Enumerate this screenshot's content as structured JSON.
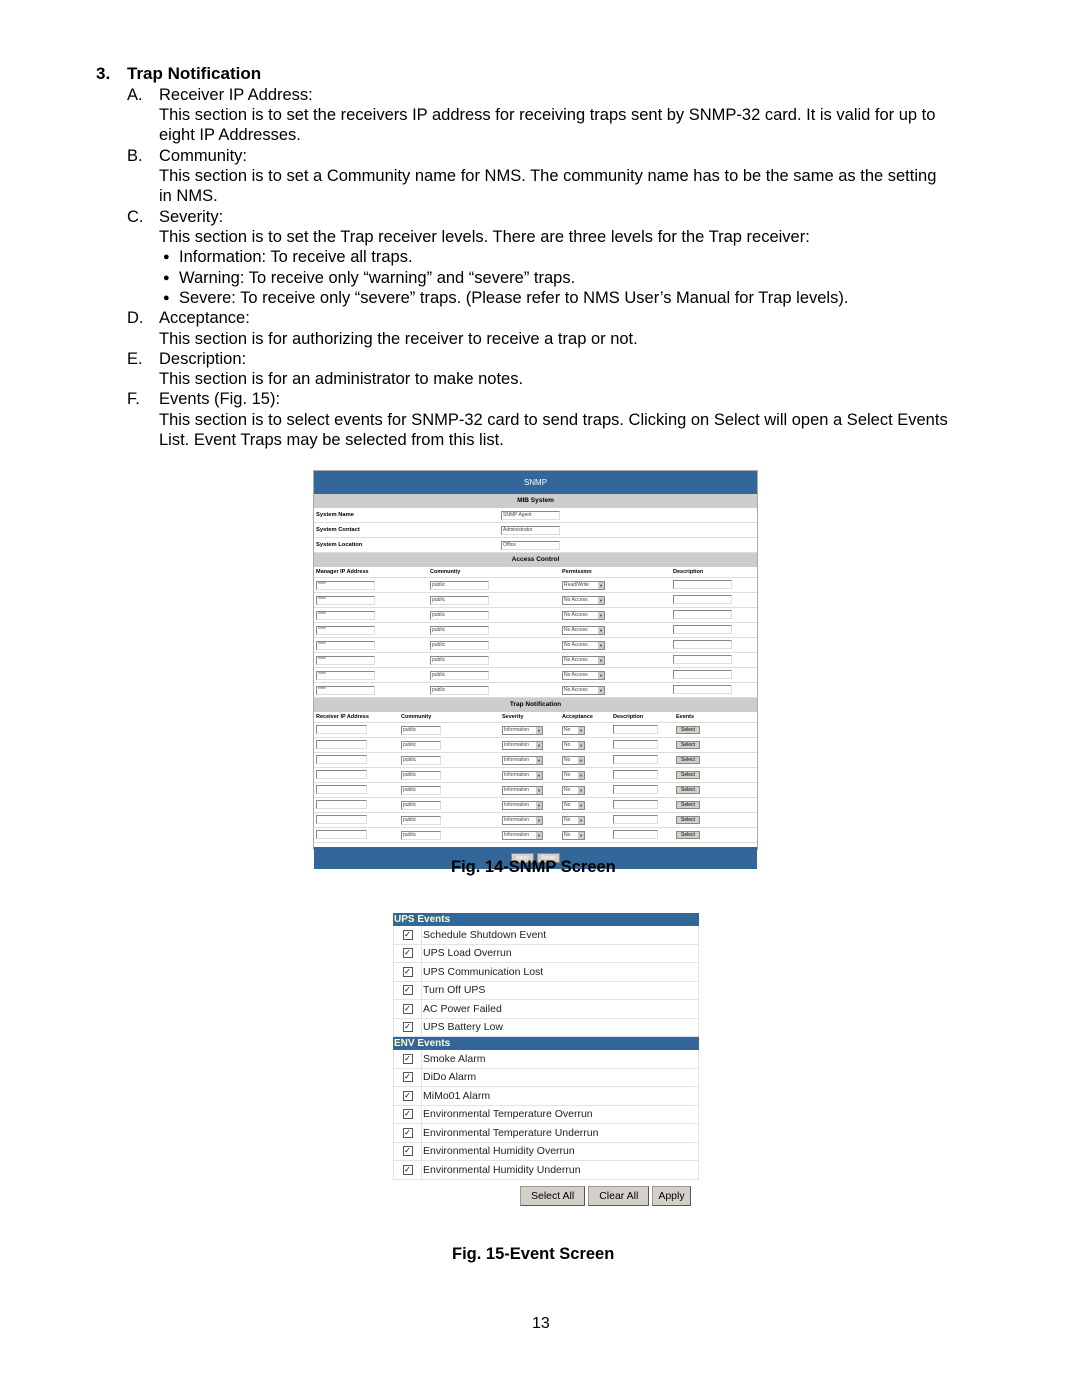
{
  "section": {
    "number": "3.",
    "title": "Trap Notification"
  },
  "items": [
    {
      "letter": "A.",
      "label": "Receiver IP Address:",
      "lines": [
        "This section is to set the receivers IP address for receiving traps sent by SNMP-32 card.  It is valid for up to",
        "eight IP Addresses."
      ]
    },
    {
      "letter": "B.",
      "label": "Community:",
      "lines": [
        "This section is to set a Community name for NMS. The community name has to be the same as the setting",
        "in NMS."
      ]
    },
    {
      "letter": "C.",
      "label": "Severity:",
      "lines": [
        "This section is to set the Trap receiver levels.  There are three levels for the Trap receiver:"
      ]
    },
    {
      "letter": "D.",
      "label": "Acceptance:",
      "lines": [
        "This section is for authorizing the receiver to receive a trap or not."
      ]
    },
    {
      "letter": "E.",
      "label": "Description:",
      "lines": [
        "This section is for an administrator to make notes."
      ]
    },
    {
      "letter": "F.",
      "label": "Events (Fig. 15):",
      "lines": [
        "This section is to select events for SNMP-32 card to send traps.  Clicking on Select will open a Select Events",
        "List.  Event Traps may be selected from this list."
      ]
    }
  ],
  "bullets": [
    "Information: To receive all traps.",
    "Warning: To receive only “warning” and “severe” traps.",
    "Severe: To receive only “severe” traps. (Please refer to NMS User’s Manual for Trap levels)."
  ],
  "snmp": {
    "title": "SNMP",
    "mib_title": "MIB System",
    "mib": [
      {
        "label": "System Name",
        "value": "SNMP Agent"
      },
      {
        "label": "System Contact",
        "value": "Administrator"
      },
      {
        "label": "System Location",
        "value": "Office"
      }
    ],
    "access_title": "Access Control",
    "access_headers": [
      "Manager IP Address",
      "Community",
      "Permission",
      "Description"
    ],
    "access_rows": [
      {
        "ip": "****",
        "community": "public",
        "permission": "Read/Write",
        "description": ""
      },
      {
        "ip": "****",
        "community": "public",
        "permission": "No Access",
        "description": ""
      },
      {
        "ip": "****",
        "community": "public",
        "permission": "No Access",
        "description": ""
      },
      {
        "ip": "****",
        "community": "public",
        "permission": "No Access",
        "description": ""
      },
      {
        "ip": "****",
        "community": "public",
        "permission": "No Access",
        "description": ""
      },
      {
        "ip": "****",
        "community": "public",
        "permission": "No Access",
        "description": ""
      },
      {
        "ip": "****",
        "community": "public",
        "permission": "No Access",
        "description": ""
      },
      {
        "ip": "****",
        "community": "public",
        "permission": "No Access",
        "description": ""
      }
    ],
    "trap_title": "Trap Notification",
    "trap_headers": [
      "Receiver IP Address",
      "Community",
      "Severity",
      "Acceptance",
      "Description",
      "Events"
    ],
    "trap_rows": [
      {
        "ip": "",
        "community": "public",
        "severity": "Information",
        "acceptance": "No",
        "description": "",
        "events": "Select"
      },
      {
        "ip": "",
        "community": "public",
        "severity": "Information",
        "acceptance": "No",
        "description": "",
        "events": "Select"
      },
      {
        "ip": "",
        "community": "public",
        "severity": "Information",
        "acceptance": "No",
        "description": "",
        "events": "Select"
      },
      {
        "ip": "",
        "community": "public",
        "severity": "Information",
        "acceptance": "No",
        "description": "",
        "events": "Select"
      },
      {
        "ip": "",
        "community": "public",
        "severity": "Information",
        "acceptance": "No",
        "description": "",
        "events": "Select"
      },
      {
        "ip": "",
        "community": "public",
        "severity": "Information",
        "acceptance": "No",
        "description": "",
        "events": "Select"
      },
      {
        "ip": "",
        "community": "public",
        "severity": "Information",
        "acceptance": "No",
        "description": "",
        "events": "Select"
      },
      {
        "ip": "",
        "community": "public",
        "severity": "Information",
        "acceptance": "No",
        "description": "",
        "events": "Select"
      }
    ],
    "apply": "Apply",
    "reset": "Reset"
  },
  "fig14": "Fig. 14-SNMP Screen",
  "events": {
    "groups": [
      {
        "title": "UPS Events",
        "items": [
          "Schedule Shutdown Event",
          "UPS Load Overrun",
          "UPS Communication Lost",
          "Turn Off UPS",
          "AC Power Failed",
          "UPS Battery Low"
        ]
      },
      {
        "title": "ENV Events",
        "items": [
          "Smoke Alarm",
          "DiDo Alarm",
          "MiMo01 Alarm",
          "Environmental Temperature Overrun",
          "Environmental Temperature Underrun",
          "Environmental Humidity Overrun",
          "Environmental Humidity Underrun"
        ]
      }
    ],
    "select_all": "Select All",
    "clear_all": "Clear All",
    "apply": "Apply"
  },
  "fig15": "Fig. 15-Event Screen",
  "page_number": "13",
  "colors": {
    "header_blue": "#336699",
    "section_grey": "#cccccc",
    "event_header_text": "#ffffcc"
  }
}
